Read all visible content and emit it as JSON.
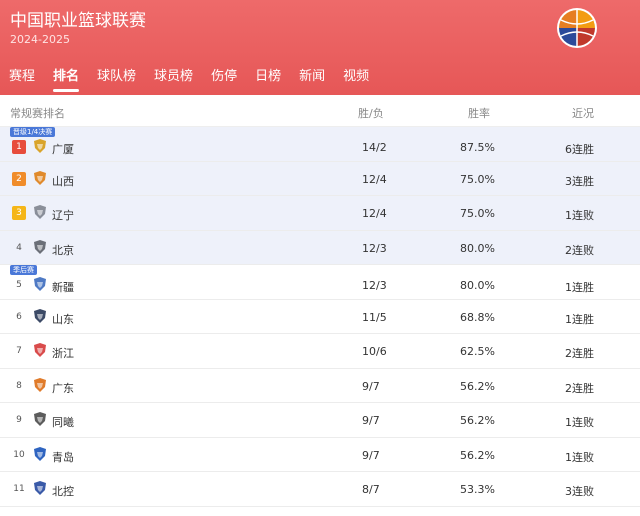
{
  "header": {
    "title": "中国职业篮球联赛",
    "season": "2024-2025"
  },
  "tabs": [
    {
      "label": "赛程",
      "active": false
    },
    {
      "label": "排名",
      "active": true
    },
    {
      "label": "球队榜",
      "active": false
    },
    {
      "label": "球员榜",
      "active": false
    },
    {
      "label": "伤停",
      "active": false
    },
    {
      "label": "日榜",
      "active": false
    },
    {
      "label": "新闻",
      "active": false
    },
    {
      "label": "视频",
      "active": false
    }
  ],
  "table": {
    "headers": {
      "name": "常规赛排名",
      "record": "胜/负",
      "pct": "胜率",
      "streak": "近况"
    },
    "badges": {
      "quarterfinal": "晋级1/4决赛",
      "playoff": "季后赛"
    },
    "rows": [
      {
        "rank": "1",
        "team": "广厦",
        "record": "14/2",
        "pct": "87.5%",
        "streak": "6连胜",
        "color": "#d9a42a"
      },
      {
        "rank": "2",
        "team": "山西",
        "record": "12/4",
        "pct": "75.0%",
        "streak": "3连胜",
        "color": "#e08a2c"
      },
      {
        "rank": "3",
        "team": "辽宁",
        "record": "12/4",
        "pct": "75.0%",
        "streak": "1连败",
        "color": "#8a8f99"
      },
      {
        "rank": "4",
        "team": "北京",
        "record": "12/3",
        "pct": "80.0%",
        "streak": "2连败",
        "color": "#6b6f78"
      },
      {
        "rank": "5",
        "team": "新疆",
        "record": "12/3",
        "pct": "80.0%",
        "streak": "1连胜",
        "color": "#4f7ac4"
      },
      {
        "rank": "6",
        "team": "山东",
        "record": "11/5",
        "pct": "68.8%",
        "streak": "1连胜",
        "color": "#3c4a66"
      },
      {
        "rank": "7",
        "team": "浙江",
        "record": "10/6",
        "pct": "62.5%",
        "streak": "2连胜",
        "color": "#d94b4b"
      },
      {
        "rank": "8",
        "team": "广东",
        "record": "9/7",
        "pct": "56.2%",
        "streak": "2连胜",
        "color": "#e07b2a"
      },
      {
        "rank": "9",
        "team": "同曦",
        "record": "9/7",
        "pct": "56.2%",
        "streak": "1连败",
        "color": "#5c5c5c"
      },
      {
        "rank": "10",
        "team": "青岛",
        "record": "9/7",
        "pct": "56.2%",
        "streak": "1连败",
        "color": "#2f64c0"
      },
      {
        "rank": "11",
        "team": "北控",
        "record": "8/7",
        "pct": "53.3%",
        "streak": "3连败",
        "color": "#3a5aa8"
      }
    ]
  }
}
